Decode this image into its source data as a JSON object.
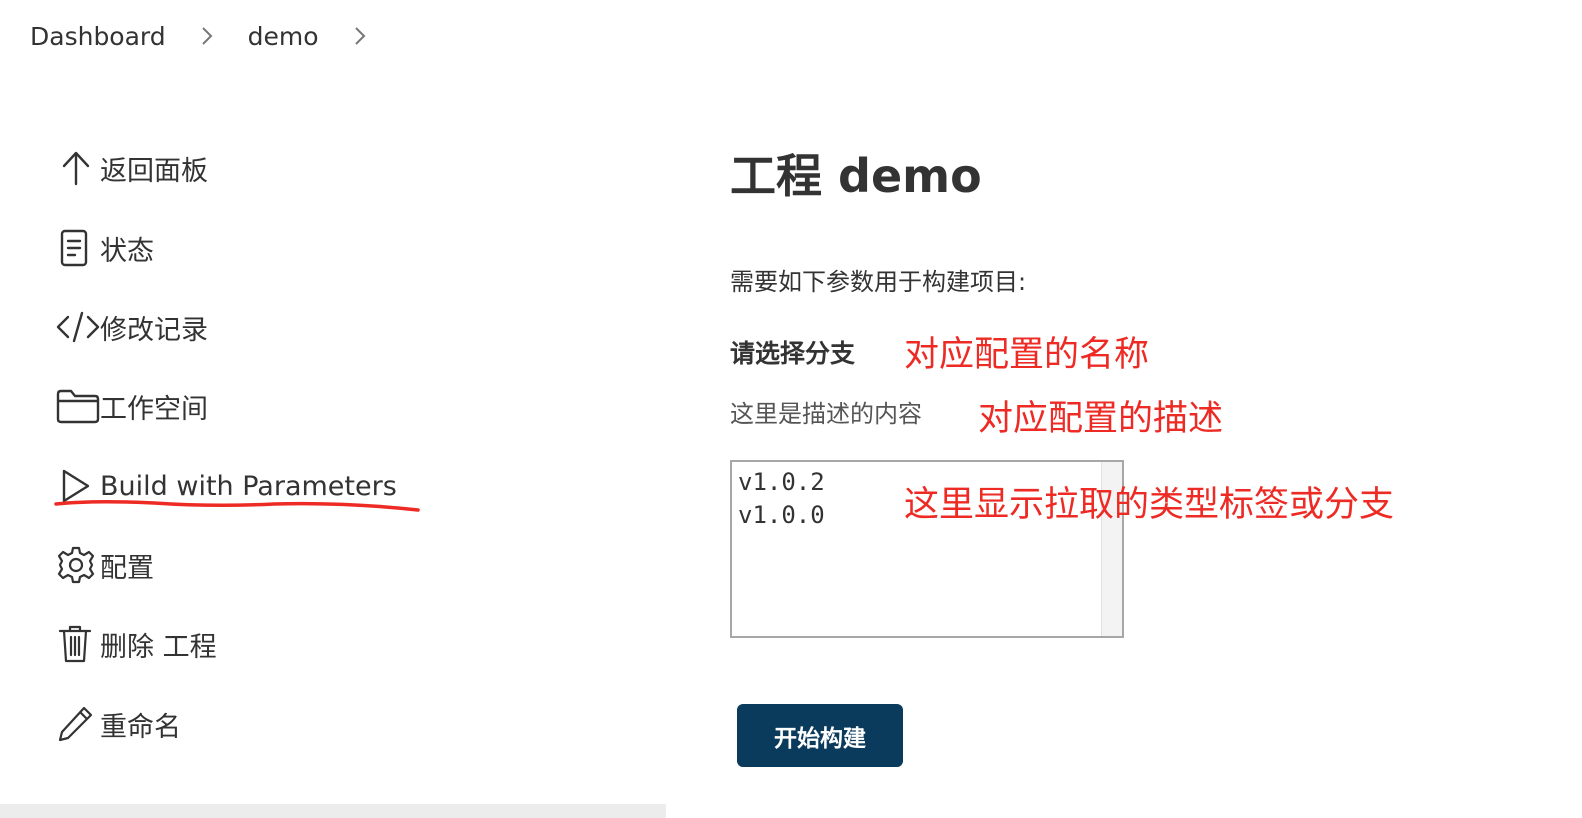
{
  "breadcrumb": {
    "items": [
      "Dashboard",
      "demo"
    ]
  },
  "sidebar": {
    "items": [
      {
        "label": "返回面板",
        "icon": "arrow-up-icon"
      },
      {
        "label": "状态",
        "icon": "document-icon"
      },
      {
        "label": "修改记录",
        "icon": "code-icon"
      },
      {
        "label": "工作空间",
        "icon": "folder-icon"
      },
      {
        "label": "Build with Parameters",
        "icon": "play-icon"
      },
      {
        "label": "配置",
        "icon": "gear-icon"
      },
      {
        "label": "删除 工程",
        "icon": "trash-icon"
      },
      {
        "label": "重命名",
        "icon": "pencil-icon"
      }
    ]
  },
  "main": {
    "title": "工程 demo",
    "params_intro": "需要如下参数用于构建项目:",
    "param": {
      "label": "请选择分支",
      "description": "这里是描述的内容",
      "options": [
        "v1.0.2",
        "v1.0.0"
      ]
    },
    "build_button": "开始构建"
  },
  "annotations": {
    "name_note": "对应配置的名称",
    "desc_note": "对应配置的描述",
    "options_note": "这里显示拉取的类型标签或分支",
    "color": "#ee2a24"
  },
  "colors": {
    "button_bg": "#0b3b5c",
    "text": "#333333"
  }
}
